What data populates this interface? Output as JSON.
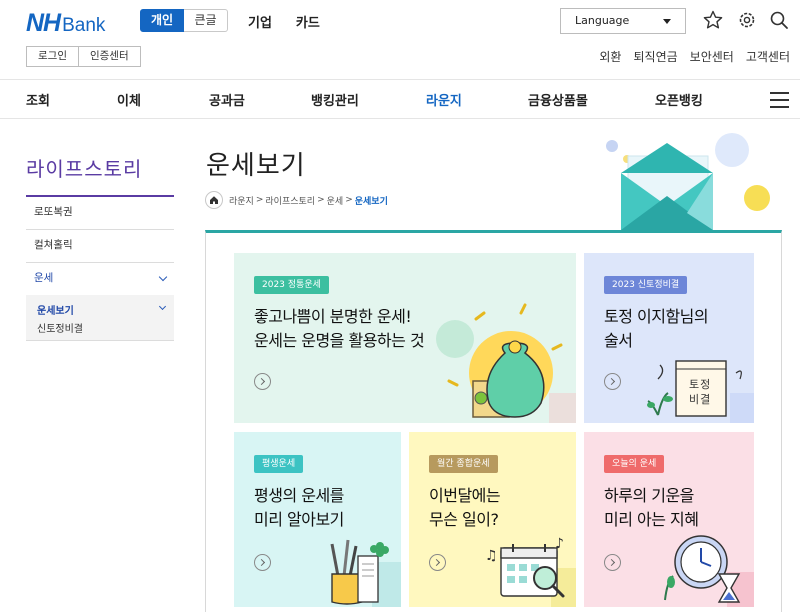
{
  "header": {
    "logo_nh": "NH",
    "logo_bank": "Bank",
    "seg_personal": "개인",
    "seg_large": "큰글",
    "topnav": [
      "기업",
      "카드"
    ],
    "language": "Language",
    "login": "로그인",
    "cert_center": "인증센터",
    "util": [
      "외환",
      "퇴직연금",
      "보안센터",
      "고객센터"
    ]
  },
  "gnb": [
    "조회",
    "이체",
    "공과금",
    "뱅킹관리",
    "라운지",
    "금융상품몰",
    "오픈뱅킹"
  ],
  "lnb": {
    "title": "라이프스토리",
    "items": [
      "로또복권",
      "컬쳐홀릭",
      "운세"
    ],
    "sub_active": "운세보기",
    "sub_item": "신토정비결"
  },
  "page": {
    "title": "운세보기",
    "breadcrumb": [
      "라운지",
      "라이프스토리",
      "운세",
      "운세보기"
    ]
  },
  "cards": [
    {
      "tag": "2023 정통운세",
      "title": "좋고나쁨이 분명한 운세!\n운세는 운명을 활용하는 것"
    },
    {
      "tag": "2023 신토정비결",
      "title": "토정 이지함님의\n술서",
      "book": "토정\n비결"
    },
    {
      "tag": "평생운세",
      "title": "평생의 운세를\n미리 알아보기"
    },
    {
      "tag": "월간 종합운세",
      "title": "이번달에는\n무슨 일이?"
    },
    {
      "tag": "오늘의 운세",
      "title": "하루의 기운을\n미리 아는 지혜"
    }
  ],
  "colors": {
    "brand_blue": "#1466c2",
    "lnb_purple": "#5a3ba3",
    "teal": "#2aa6a4",
    "tag_green": "#3cbfa0",
    "tag_blue": "#6d86d8",
    "tag_teal": "#3cc3c3",
    "tag_tan": "#b79a5e",
    "tag_red": "#ef6b6b"
  }
}
